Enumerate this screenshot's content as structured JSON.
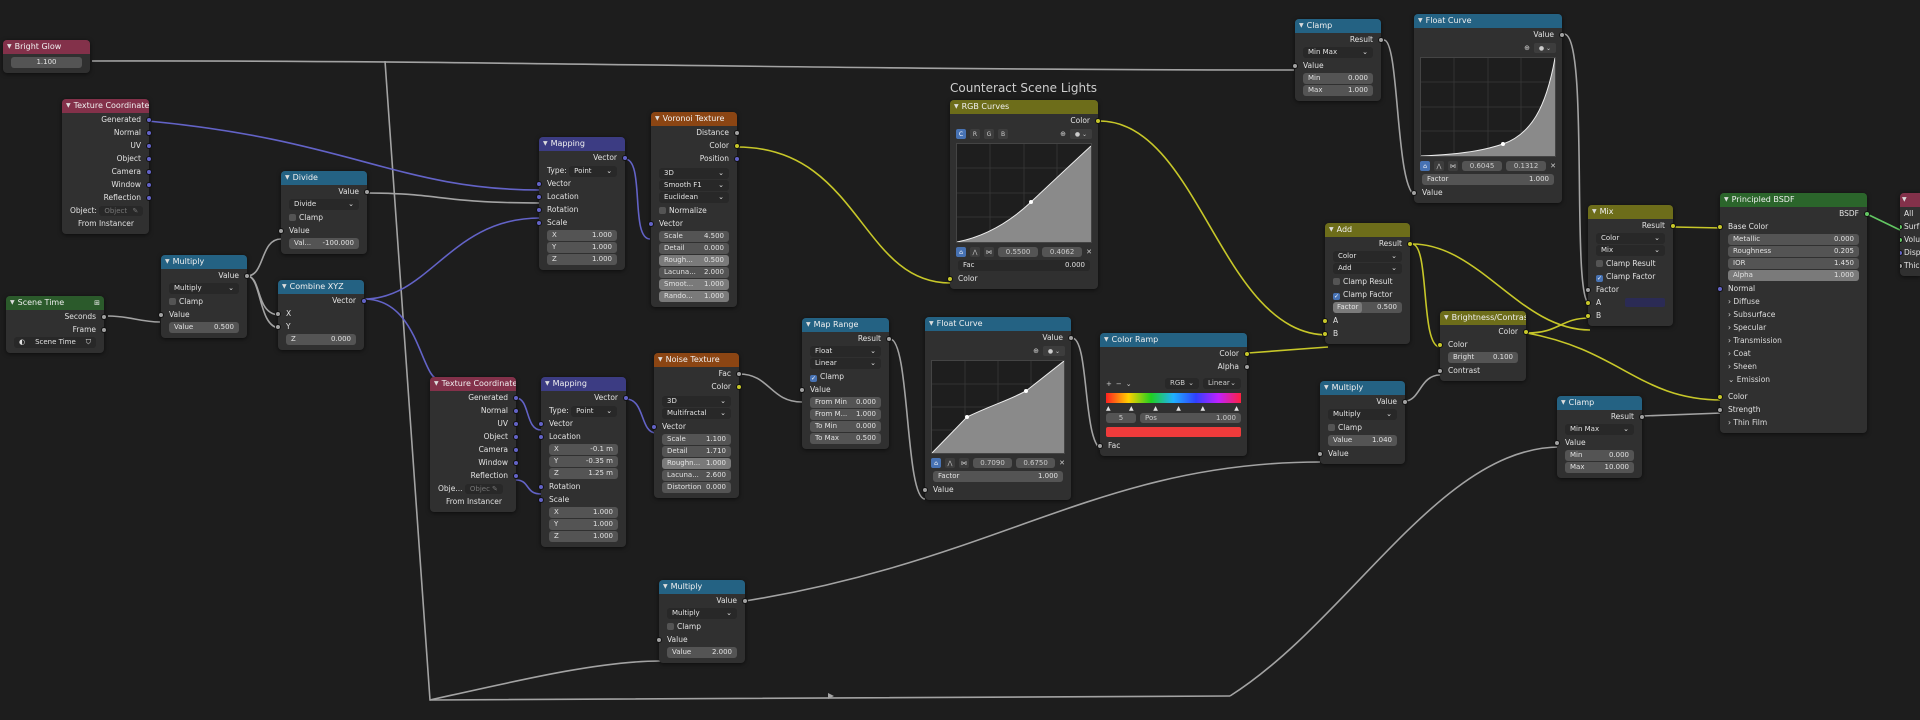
{
  "frame": {
    "label": "Counteract Scene Lights"
  },
  "bright_glow": {
    "title": "Bright Glow",
    "value": "1.100"
  },
  "tex_coord_1": {
    "title": "Texture Coordinate",
    "outputs": [
      "Generated",
      "Normal",
      "UV",
      "Object",
      "Camera",
      "Window",
      "Reflection"
    ],
    "object_label": "Object:",
    "object_placeholder": "Object",
    "from_instancer": "From Instancer"
  },
  "scene_time": {
    "title": "Scene Time",
    "outputs": [
      "Seconds",
      "Frame"
    ],
    "field": "Scene Time"
  },
  "multiply_1": {
    "title": "Multiply",
    "out": "Value",
    "op": "Multiply",
    "clamp": "Clamp",
    "in_value": "Value",
    "value_label": "Value",
    "value": "0.500"
  },
  "divide": {
    "title": "Divide",
    "out": "Value",
    "op": "Divide",
    "clamp": "Clamp",
    "in_value": "Value",
    "value_label": "Val...",
    "value": "-100.000"
  },
  "combine_xyz": {
    "title": "Combine XYZ",
    "out": "Vector",
    "x": "X",
    "y": "Y",
    "z_label": "Z",
    "z": "0.000"
  },
  "mapping_1": {
    "title": "Mapping",
    "out": "Vector",
    "type_label": "Type:",
    "type": "Point",
    "inputs": [
      "Vector",
      "Location",
      "Rotation",
      "Scale"
    ],
    "scale": [
      {
        "k": "X",
        "v": "1.000"
      },
      {
        "k": "Y",
        "v": "1.000"
      },
      {
        "k": "Z",
        "v": "1.000"
      }
    ]
  },
  "voronoi": {
    "title": "Voronoi Texture",
    "outputs": [
      "Distance",
      "Color",
      "Position"
    ],
    "dims": "3D",
    "feature": "Smooth F1",
    "metric": "Euclidean",
    "normalize": "Normalize",
    "in_vector": "Vector",
    "fields": [
      {
        "k": "Scale",
        "v": "4.500"
      },
      {
        "k": "Detail",
        "v": "0.000"
      },
      {
        "k": "Rough...",
        "v": "0.500"
      },
      {
        "k": "Lacuna...",
        "v": "2.000"
      },
      {
        "k": "Smoot...",
        "v": "1.000"
      },
      {
        "k": "Rando...",
        "v": "1.000"
      }
    ]
  },
  "tex_coord_2": {
    "title": "Texture Coordinate",
    "outputs": [
      "Generated",
      "Normal",
      "UV",
      "Object",
      "Camera",
      "Window",
      "Reflection"
    ],
    "object_label": "Obje...",
    "object_placeholder": "Objec",
    "from_instancer": "From Instancer"
  },
  "mapping_2": {
    "title": "Mapping",
    "out": "Vector",
    "type_label": "Type:",
    "type": "Point",
    "inputs": [
      "Vector",
      "Location"
    ],
    "location": [
      {
        "k": "X",
        "v": "-0.1 m"
      },
      {
        "k": "Y",
        "v": "-0.35 m"
      },
      {
        "k": "Z",
        "v": "1.25 m"
      }
    ],
    "inputs2": [
      "Rotation",
      "Scale"
    ],
    "scale": [
      {
        "k": "X",
        "v": "1.000"
      },
      {
        "k": "Y",
        "v": "1.000"
      },
      {
        "k": "Z",
        "v": "1.000"
      }
    ]
  },
  "noise": {
    "title": "Noise Texture",
    "outputs": [
      "Fac",
      "Color"
    ],
    "dims": "3D",
    "type": "Multifractal",
    "in_vector": "Vector",
    "fields": [
      {
        "k": "Scale",
        "v": "1.100"
      },
      {
        "k": "Detail",
        "v": "1.710"
      },
      {
        "k": "Roughn...",
        "v": "1.000"
      },
      {
        "k": "Lacuna...",
        "v": "2.600"
      },
      {
        "k": "Distortion",
        "v": "0.000"
      }
    ]
  },
  "multiply_bottom": {
    "title": "Multiply",
    "out": "Value",
    "op": "Multiply",
    "clamp": "Clamp",
    "in_value": "Value",
    "value_label": "Value",
    "value": "2.000"
  },
  "map_range": {
    "title": "Map Range",
    "out": "Result",
    "dtype": "Float",
    "interp": "Linear",
    "clamp": "Clamp",
    "in_value": "Value",
    "fields": [
      {
        "k": "From Min",
        "v": "0.000"
      },
      {
        "k": "From M...",
        "v": "1.000"
      },
      {
        "k": "To Min",
        "v": "0.000"
      },
      {
        "k": "To Max",
        "v": "0.500"
      }
    ]
  },
  "rgb_curves": {
    "title": "RGB Curves",
    "out": "Color",
    "channels": [
      "C",
      "R",
      "G",
      "B"
    ],
    "coords": [
      "0.5500",
      "0.4062"
    ],
    "fac_label": "Fac",
    "fac": "0.000",
    "in_color": "Color"
  },
  "float_curve_mid": {
    "title": "Float Curve",
    "out": "Value",
    "coords": [
      "0.7090",
      "0.6750"
    ],
    "factor_label": "Factor",
    "factor": "1.000",
    "in_value": "Value"
  },
  "color_ramp": {
    "title": "Color Ramp",
    "outputs": [
      "Color",
      "Alpha"
    ],
    "plus": "+",
    "minus": "−",
    "mode": "RGB",
    "interp": "Linear",
    "index": "5",
    "pos_label": "Pos",
    "pos": "1.000",
    "in_fac": "Fac",
    "active_color": "#ef3b3b"
  },
  "clamp_top": {
    "title": "Clamp",
    "out": "Result",
    "type": "Min Max",
    "in_value": "Value",
    "fields": [
      {
        "k": "Min",
        "v": "0.000"
      },
      {
        "k": "Max",
        "v": "1.000"
      }
    ]
  },
  "float_curve_top": {
    "title": "Float Curve",
    "out": "Value",
    "coords": [
      "0.6045",
      "0.1312"
    ],
    "factor_label": "Factor",
    "factor": "1.000",
    "in_value": "Value"
  },
  "add": {
    "title": "Add",
    "out": "Result",
    "dtype": "Color",
    "blend": "Add",
    "clamp_result": "Clamp Result",
    "clamp_factor": "Clamp Factor",
    "factor_label": "Factor",
    "factor": "0.500",
    "inputs": [
      "A",
      "B"
    ]
  },
  "multiply_right": {
    "title": "Multiply",
    "out": "Value",
    "op": "Multiply",
    "clamp": "Clamp",
    "value_label": "Value",
    "value": "1.040",
    "in_value": "Value"
  },
  "bright_contrast": {
    "title": "Brightness/Contrast",
    "out": "Color",
    "in_color": "Color",
    "bright_label": "Bright",
    "bright": "0.100",
    "contrast": "Contrast"
  },
  "mix": {
    "title": "Mix",
    "out": "Result",
    "dtype": "Color",
    "blend": "Mix",
    "clamp_result": "Clamp Result",
    "clamp_factor": "Clamp Factor",
    "inputs": [
      "Factor",
      "A",
      "B"
    ],
    "b_color": "#2b2b55"
  },
  "clamp_right": {
    "title": "Clamp",
    "out": "Result",
    "type": "Min Max",
    "in_value": "Value",
    "fields": [
      {
        "k": "Min",
        "v": "0.000"
      },
      {
        "k": "Max",
        "v": "10.000"
      }
    ]
  },
  "bsdf": {
    "title": "Principled BSDF",
    "out": "BSDF",
    "base_color": "Base Color",
    "fields": [
      {
        "k": "Metallic",
        "v": "0.000"
      },
      {
        "k": "Roughness",
        "v": "0.205"
      },
      {
        "k": "IOR",
        "v": "1.450"
      },
      {
        "k": "Alpha",
        "v": "1.000"
      }
    ],
    "normal": "Normal",
    "panels": [
      "Diffuse",
      "Subsurface",
      "Specular",
      "Transmission",
      "Coat",
      "Sheen"
    ],
    "emission": "Emission",
    "em_color": "Color",
    "em_strength": "Strength",
    "thin_film": "Thin Film"
  },
  "edge_output": {
    "labels": [
      "All",
      "Surf",
      "Volu",
      "Disp",
      "Thic"
    ]
  }
}
